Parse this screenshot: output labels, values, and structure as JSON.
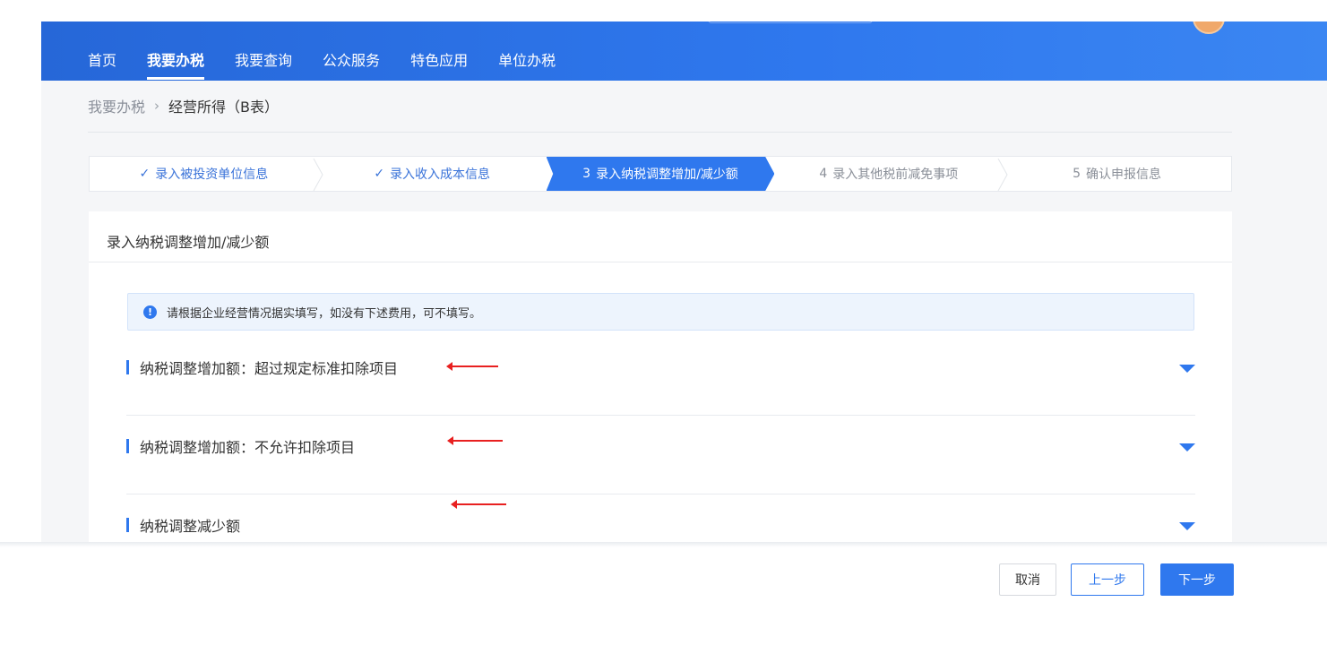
{
  "nav": {
    "items": [
      "首页",
      "我要办税",
      "我要查询",
      "公众服务",
      "特色应用",
      "单位办税"
    ],
    "active_index": 1
  },
  "breadcrumb": {
    "parent": "我要办税",
    "separator": "›",
    "current": "经营所得（B表）"
  },
  "steps": [
    {
      "mark": "✓",
      "label": "录入被投资单位信息",
      "state": "done"
    },
    {
      "mark": "✓",
      "label": "录入收入成本信息",
      "state": "done"
    },
    {
      "mark": "3",
      "label": "录入纳税调整增加/减少额",
      "state": "active"
    },
    {
      "mark": "4",
      "label": "录入其他税前减免事项",
      "state": "pending"
    },
    {
      "mark": "5",
      "label": "确认申报信息",
      "state": "pending"
    }
  ],
  "card": {
    "title": "录入纳税调整增加/减少额",
    "notice": "请根据企业经营情况据实填写，如没有下述费用，可不填写。",
    "sections": [
      "纳税调整增加额：超过规定标准扣除项目",
      "纳税调整增加额：不允许扣除项目",
      "纳税调整减少额"
    ]
  },
  "icons": {
    "notice": "info-icon",
    "section_toggle": "caret-down-icon",
    "annotation": "red-arrow-icon"
  },
  "footer": {
    "cancel": "取消",
    "prev": "上一步",
    "next": "下一步"
  },
  "colors": {
    "primary": "#2f78ee",
    "annotation": "#e82020",
    "avatar": "#f0a86a"
  }
}
